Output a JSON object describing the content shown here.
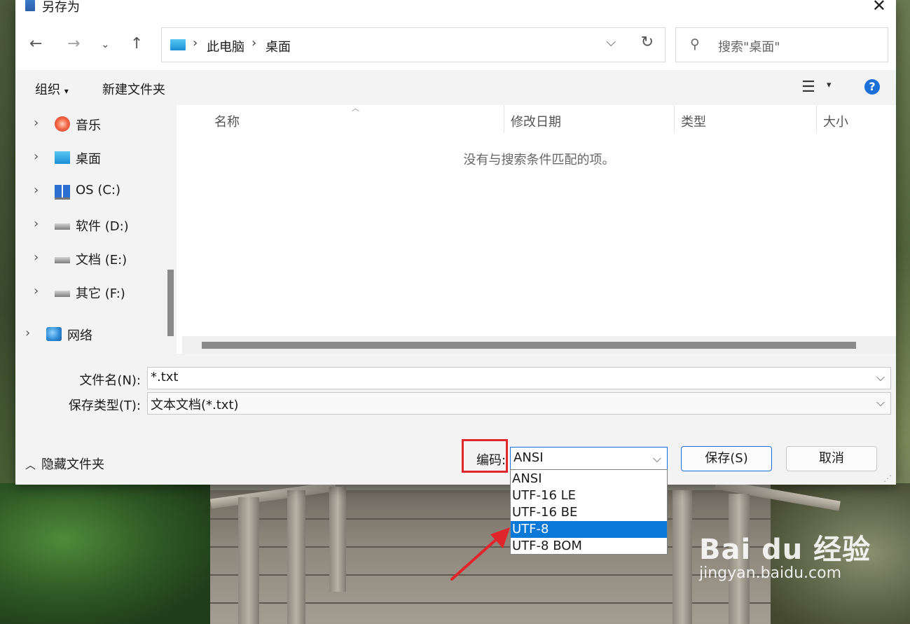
{
  "window": {
    "title": "另存为"
  },
  "address_bar": {
    "crumbs": [
      "此电脑",
      "桌面"
    ]
  },
  "search": {
    "placeholder": "搜索\"桌面\""
  },
  "toolbar": {
    "organize": "组织",
    "new_folder": "新建文件夹"
  },
  "nav_pane": {
    "items": [
      {
        "label": "音乐",
        "icon": "music-icon"
      },
      {
        "label": "桌面",
        "icon": "desktop-icon"
      },
      {
        "label": "OS (C:)",
        "icon": "os-drive-icon"
      },
      {
        "label": "软件 (D:)",
        "icon": "drive-icon"
      },
      {
        "label": "文档 (E:)",
        "icon": "drive-icon"
      },
      {
        "label": "其它 (F:)",
        "icon": "drive-icon"
      },
      {
        "label": "网络",
        "icon": "network-icon"
      }
    ]
  },
  "file_list": {
    "columns": [
      "名称",
      "修改日期",
      "类型",
      "大小"
    ],
    "empty_message": "没有与搜索条件匹配的项。"
  },
  "form": {
    "filename_label": "文件名(N):",
    "filename_value": "*.txt",
    "filetype_label": "保存类型(T):",
    "filetype_value": "文本文档(*.txt)"
  },
  "bottom": {
    "hide_folders": "隐藏文件夹",
    "encoding_label": "编码:",
    "encoding_value": "ANSI",
    "save_button": "保存(S)",
    "cancel_button": "取消"
  },
  "encoding_dropdown": {
    "options": [
      "ANSI",
      "UTF-16 LE",
      "UTF-16 BE",
      "UTF-8",
      "UTF-8 BOM"
    ],
    "highlighted": "UTF-8"
  },
  "watermark": {
    "brand": "Bai du 经验",
    "url": "jingyan.baidu.com"
  },
  "colors": {
    "accent": "#0a78d7",
    "annotation": "#e0262c",
    "help": "#1a6fd8"
  }
}
